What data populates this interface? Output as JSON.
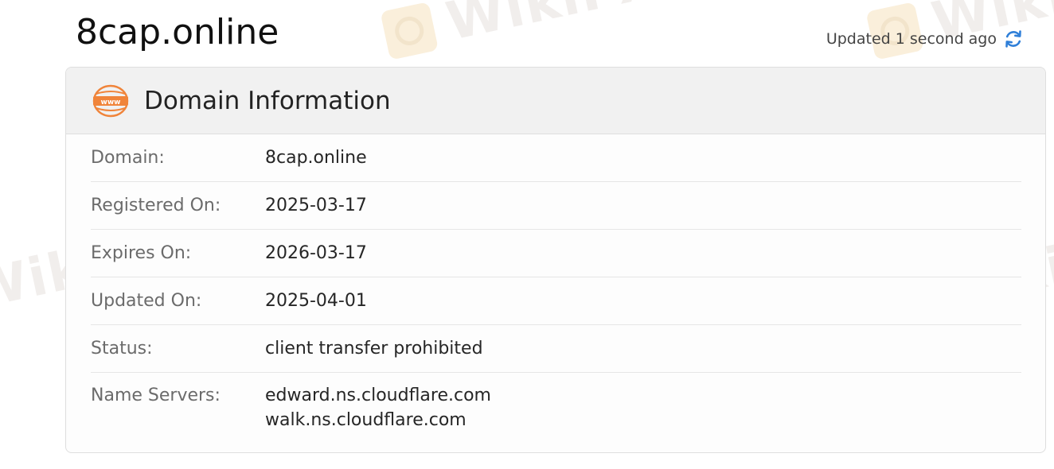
{
  "page": {
    "domain": "8cap.online",
    "updated_text": "Updated 1 second ago"
  },
  "card": {
    "title": "Domain Information",
    "icon": "www-icon",
    "rows": [
      {
        "label": "Domain:",
        "value": "8cap.online"
      },
      {
        "label": "Registered On:",
        "value": "2025-03-17"
      },
      {
        "label": "Expires On:",
        "value": "2026-03-17"
      },
      {
        "label": "Updated On:",
        "value": "2025-04-01"
      },
      {
        "label": "Status:",
        "value": "client transfer prohibited"
      },
      {
        "label": "Name Servers:",
        "values": [
          "edward.ns.cloudflare.com",
          "walk.ns.cloudflare.com"
        ]
      }
    ]
  },
  "watermark": {
    "text": "WikiFX"
  },
  "colors": {
    "accent_orange": "#f0843a",
    "refresh_blue": "#2f7fd8",
    "header_bg": "#f1f1f1"
  }
}
